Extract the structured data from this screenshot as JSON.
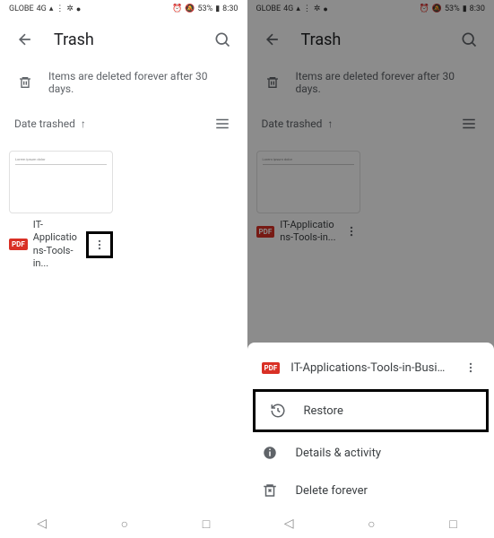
{
  "status": {
    "carrier": "GLOBE",
    "signal": "4G",
    "battery_pct": "53%",
    "time": "8:30"
  },
  "appbar": {
    "title": "Trash"
  },
  "info": {
    "message": "Items are deleted forever after 30 days."
  },
  "sort": {
    "label": "Date trashed"
  },
  "file": {
    "badge": "PDF",
    "name_line1": "IT-Applicatio",
    "name_line2": "ns-Tools-in..."
  },
  "sheet": {
    "file_badge": "PDF",
    "file_name": "IT-Applications-Tools-in-Business-...",
    "restore": "Restore",
    "details": "Details & activity",
    "delete": "Delete forever"
  }
}
